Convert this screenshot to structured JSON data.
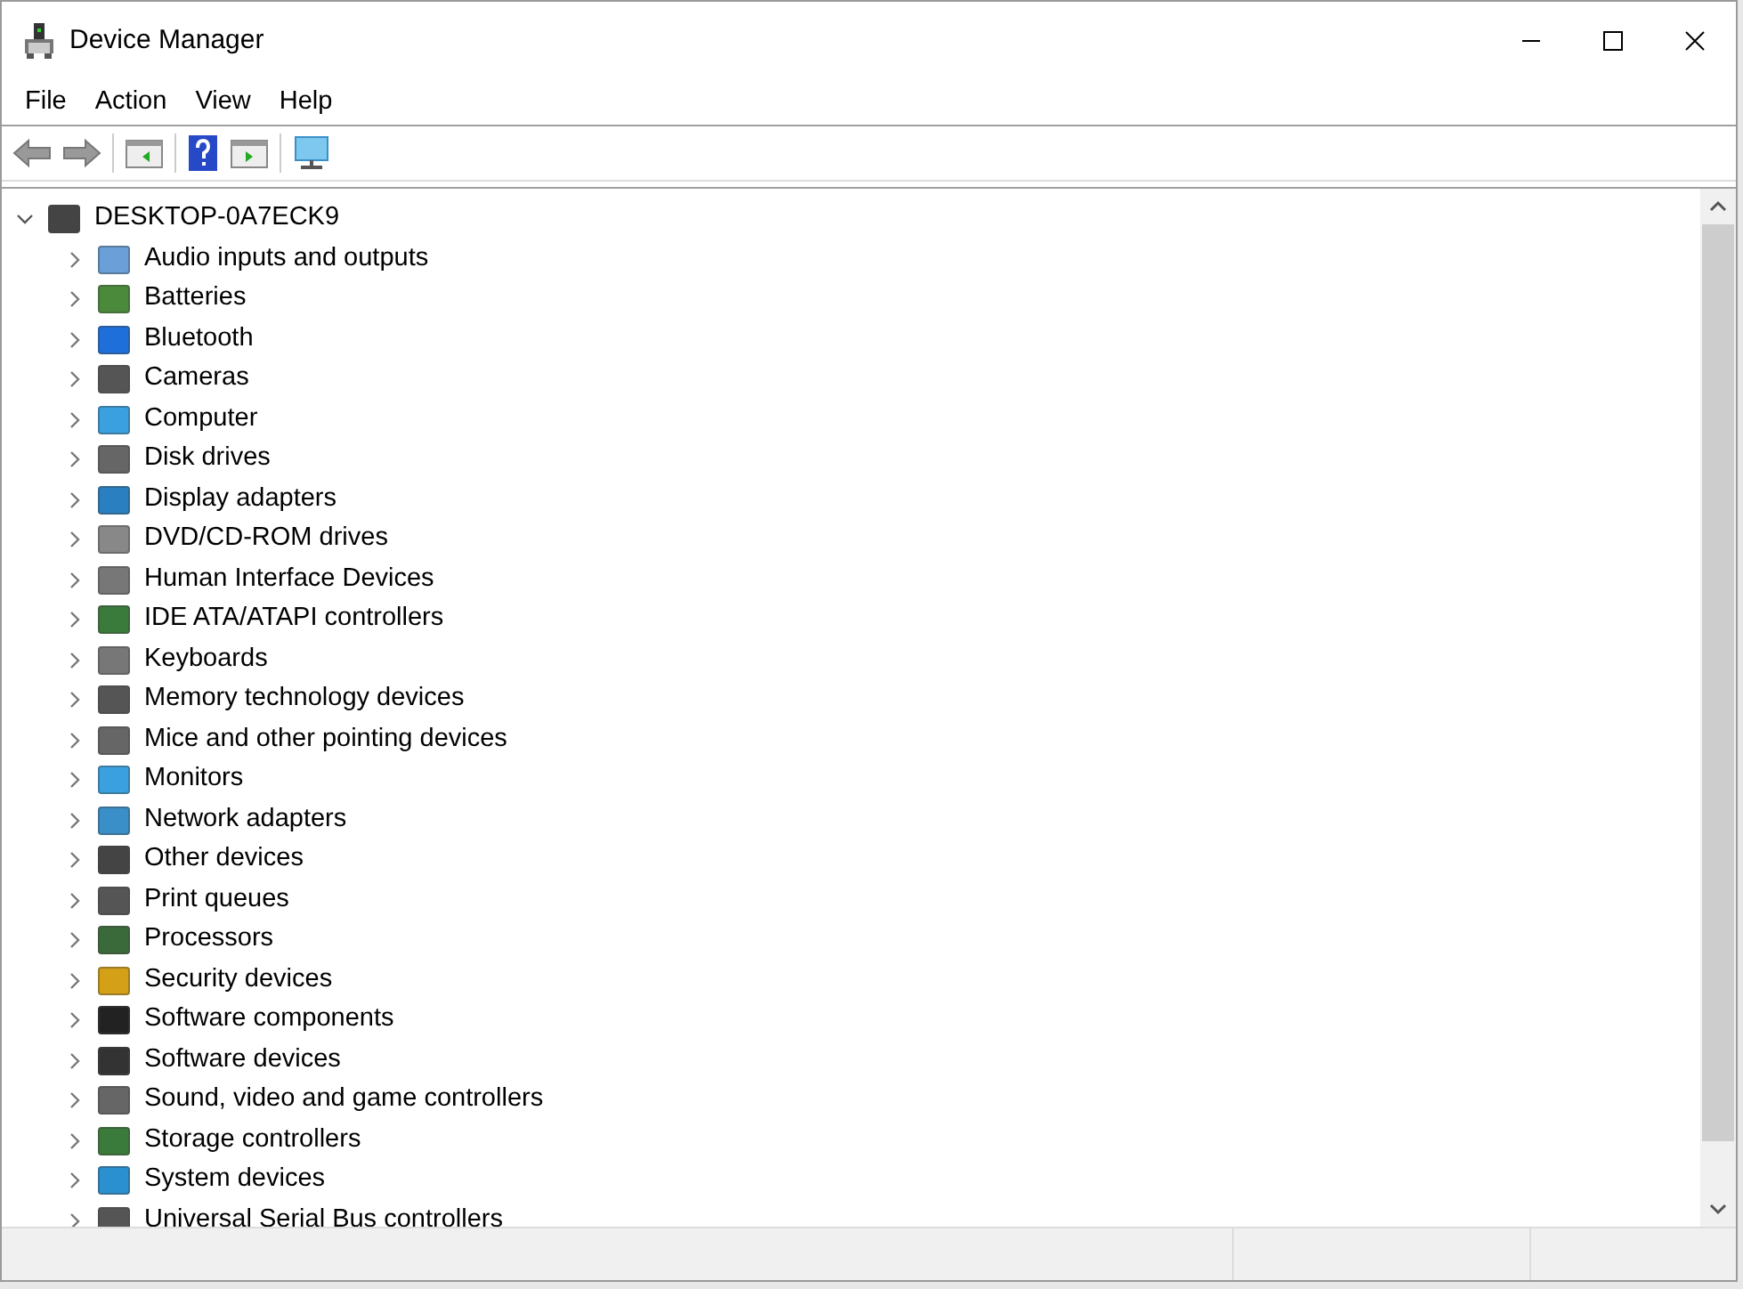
{
  "window": {
    "title": "Device Manager"
  },
  "menu": [
    "File",
    "Action",
    "View",
    "Help"
  ],
  "tree": {
    "label": "DESKTOP-0A7ECK9",
    "expanded": true,
    "children": [
      {
        "label": "Audio inputs and outputs",
        "expanded": false
      },
      {
        "label": "Batteries",
        "expanded": false
      },
      {
        "label": "Bluetooth",
        "expanded": false
      },
      {
        "label": "Cameras",
        "expanded": false
      },
      {
        "label": "Computer",
        "expanded": false
      },
      {
        "label": "Disk drives",
        "expanded": false
      },
      {
        "label": "Display adapters",
        "expanded": false
      },
      {
        "label": "DVD/CD-ROM drives",
        "expanded": false
      },
      {
        "label": "Human Interface Devices",
        "expanded": false
      },
      {
        "label": "IDE ATA/ATAPI controllers",
        "expanded": false
      },
      {
        "label": "Keyboards",
        "expanded": false
      },
      {
        "label": "Memory technology devices",
        "expanded": false
      },
      {
        "label": "Mice and other pointing devices",
        "expanded": false
      },
      {
        "label": "Monitors",
        "expanded": false
      },
      {
        "label": "Network adapters",
        "expanded": false
      },
      {
        "label": "Other devices",
        "expanded": false
      },
      {
        "label": "Print queues",
        "expanded": false
      },
      {
        "label": "Processors",
        "expanded": false
      },
      {
        "label": "Security devices",
        "expanded": false
      },
      {
        "label": "Software components",
        "expanded": false
      },
      {
        "label": "Software devices",
        "expanded": false
      },
      {
        "label": "Sound, video and game controllers",
        "expanded": false
      },
      {
        "label": "Storage controllers",
        "expanded": false
      },
      {
        "label": "System devices",
        "expanded": false
      },
      {
        "label": "Universal Serial Bus controllers",
        "expanded": false
      }
    ]
  }
}
